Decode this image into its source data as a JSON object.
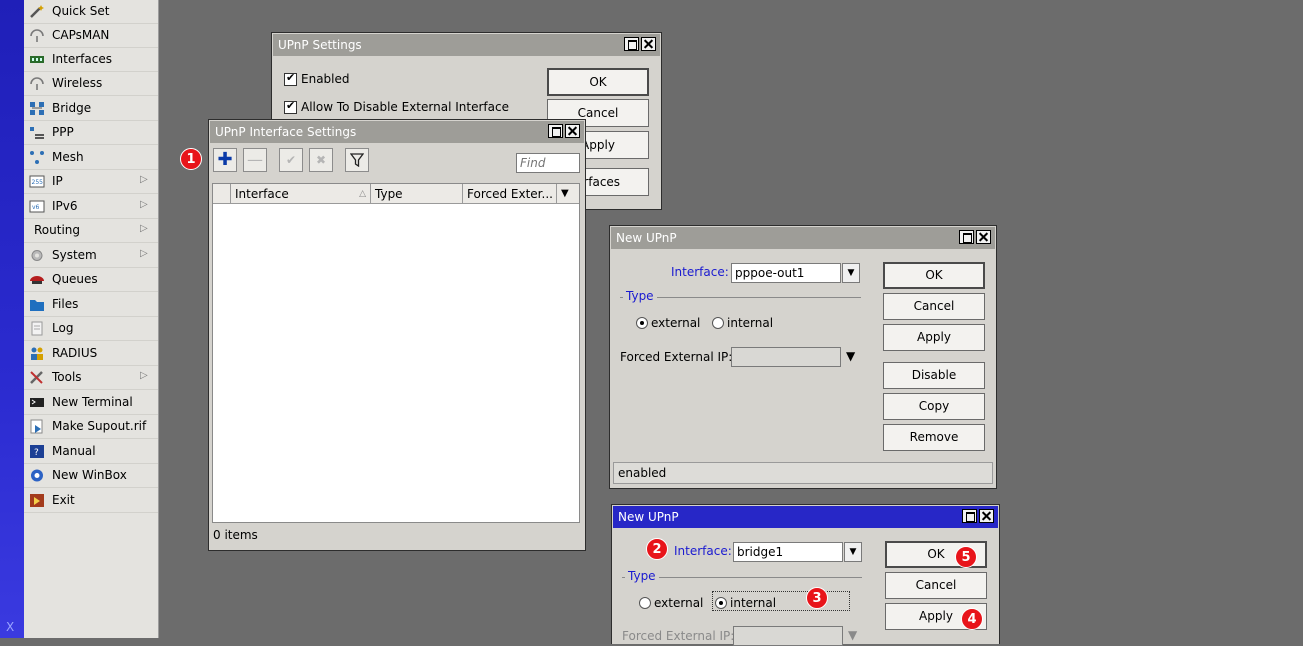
{
  "sidebar": {
    "vertical_label": "X",
    "items": [
      {
        "label": "Quick Set",
        "icon": "wand-icon",
        "submenu": false
      },
      {
        "label": "CAPsMAN",
        "icon": "capsman-icon",
        "submenu": false
      },
      {
        "label": "Interfaces",
        "icon": "interfaces-icon",
        "submenu": false
      },
      {
        "label": "Wireless",
        "icon": "wireless-icon",
        "submenu": false
      },
      {
        "label": "Bridge",
        "icon": "bridge-icon",
        "submenu": false
      },
      {
        "label": "PPP",
        "icon": "ppp-icon",
        "submenu": false
      },
      {
        "label": "Mesh",
        "icon": "mesh-icon",
        "submenu": false
      },
      {
        "label": "IP",
        "icon": "ip-icon",
        "submenu": true
      },
      {
        "label": "IPv6",
        "icon": "ipv6-icon",
        "submenu": true
      },
      {
        "label": "Routing",
        "icon": "",
        "submenu": true
      },
      {
        "label": "System",
        "icon": "system-icon",
        "submenu": true
      },
      {
        "label": "Queues",
        "icon": "queues-icon",
        "submenu": false
      },
      {
        "label": "Files",
        "icon": "folder-icon",
        "submenu": false
      },
      {
        "label": "Log",
        "icon": "log-icon",
        "submenu": false
      },
      {
        "label": "RADIUS",
        "icon": "radius-icon",
        "submenu": false
      },
      {
        "label": "Tools",
        "icon": "tools-icon",
        "submenu": true
      },
      {
        "label": "New Terminal",
        "icon": "terminal-icon",
        "submenu": false
      },
      {
        "label": "Make Supout.rif",
        "icon": "supout-icon",
        "submenu": false
      },
      {
        "label": "Manual",
        "icon": "manual-icon",
        "submenu": false
      },
      {
        "label": "New WinBox",
        "icon": "winbox-icon",
        "submenu": false
      },
      {
        "label": "Exit",
        "icon": "exit-icon",
        "submenu": false
      }
    ]
  },
  "upnp_settings": {
    "title": "UPnP Settings",
    "enabled_label": "Enabled",
    "enabled": true,
    "allow_disable_label": "Allow To Disable External Interface",
    "allow_disable": true,
    "buttons": {
      "ok": "OK",
      "cancel": "Cancel",
      "apply": "Apply",
      "interfaces": "Interfaces"
    },
    "buttons_visible": {
      "apply": "Apply",
      "interfaces": "erfaces"
    }
  },
  "iface_settings": {
    "title": "UPnP Interface Settings",
    "find_placeholder": "Find",
    "columns": [
      "Interface",
      "Type",
      "Forced Exter..."
    ],
    "rows": [],
    "status": "0 items"
  },
  "new_upnp_1": {
    "title": "New UPnP",
    "interface_label": "Interface:",
    "interface_value": "pppoe-out1",
    "type_group": "Type",
    "type_options": [
      "external",
      "internal"
    ],
    "type_selected": "external",
    "forced_ip_label": "Forced External IP:",
    "forced_ip_value": "",
    "buttons": {
      "ok": "OK",
      "cancel": "Cancel",
      "apply": "Apply",
      "disable": "Disable",
      "copy": "Copy",
      "remove": "Remove"
    },
    "status": "enabled"
  },
  "new_upnp_2": {
    "title": "New UPnP",
    "interface_label": "Interface:",
    "interface_value": "bridge1",
    "type_group": "Type",
    "type_options": [
      "external",
      "internal"
    ],
    "type_selected": "internal",
    "forced_ip_label": "Forced External IP:",
    "buttons": {
      "ok": "OK",
      "cancel": "Cancel",
      "apply": "Apply"
    }
  },
  "annotations": [
    "1",
    "2",
    "3",
    "4",
    "5"
  ],
  "colors": {
    "active_title": "#2727c7",
    "inactive_title": "#9e9d98",
    "badge": "#e8141a",
    "desktop": "#6c6c6c",
    "menu": "#e4e3df"
  }
}
